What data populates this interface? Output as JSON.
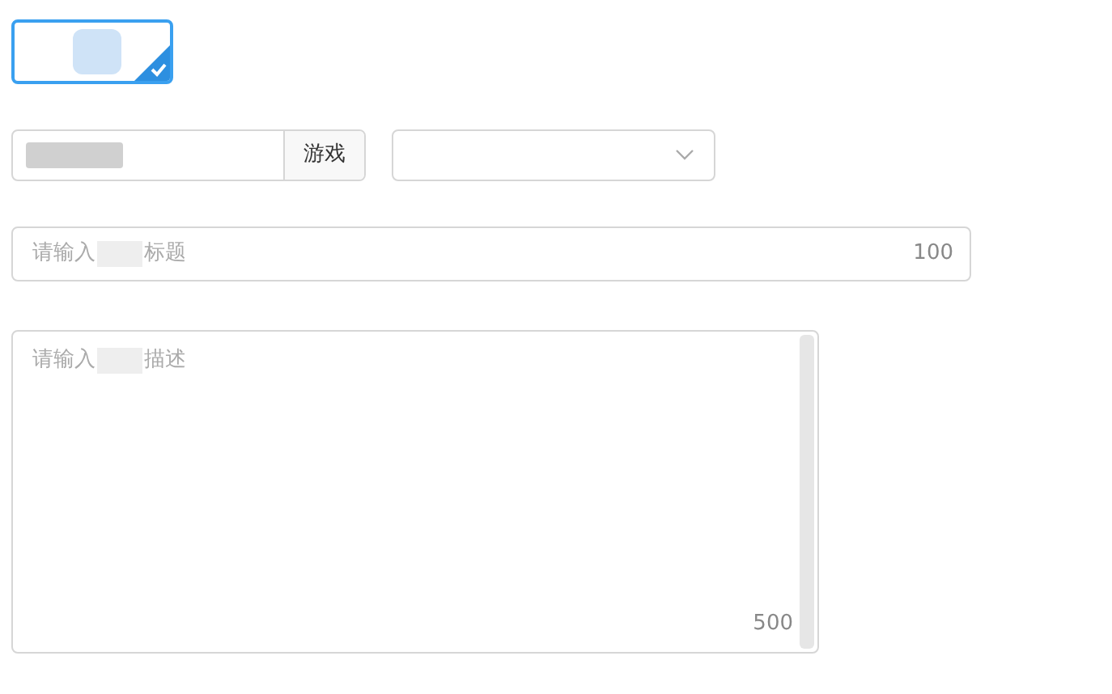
{
  "cover_card": {
    "selected": true
  },
  "category_input": {
    "addon": "游戏"
  },
  "title_field": {
    "placeholder_before": "请输入",
    "placeholder_after": "标题",
    "counter": "100"
  },
  "description_field": {
    "placeholder_before": "请输入",
    "placeholder_after": "描述",
    "counter": "500"
  }
}
